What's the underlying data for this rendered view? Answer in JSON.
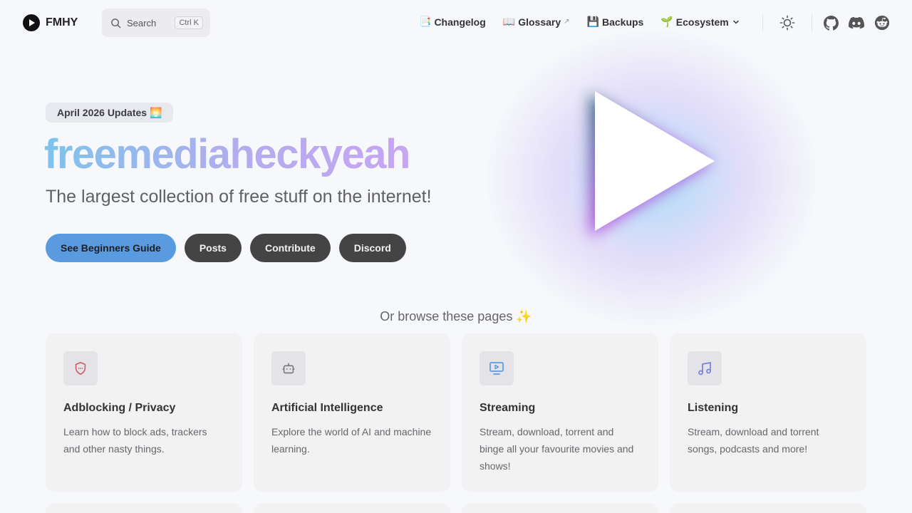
{
  "nav": {
    "logo_text": "FMHY",
    "search_label": "Search",
    "search_kbd_1": "Ctrl",
    "search_kbd_2": "K",
    "links": [
      {
        "emoji": "📑",
        "label": "Changelog"
      },
      {
        "emoji": "📖",
        "label": "Glossary",
        "external": "↗"
      },
      {
        "emoji": "💾",
        "label": "Backups"
      },
      {
        "emoji": "🌱",
        "label": "Ecosystem"
      }
    ]
  },
  "hero": {
    "badge": "April 2026 Updates 🌅",
    "title": "freemediaheckyeah",
    "tagline": "The largest collection of free stuff on the internet!",
    "actions": [
      "See Beginners Guide",
      "Posts",
      "Contribute",
      "Discord"
    ]
  },
  "browse": {
    "heading": "Or browse these pages ✨",
    "cards": [
      {
        "title": "Adblocking / Privacy",
        "desc": "Learn how to block ads, trackers and other nasty things.",
        "icon": "shield-icon"
      },
      {
        "title": "Artificial Intelligence",
        "desc": "Explore the world of AI and machine learning.",
        "icon": "robot-icon"
      },
      {
        "title": "Streaming",
        "desc": "Stream, download, torrent and binge all your favourite movies and shows!",
        "icon": "monitor-play-icon"
      },
      {
        "title": "Listening",
        "desc": "Stream, download and torrent songs, podcasts and more!",
        "icon": "music-note-icon"
      }
    ]
  },
  "colors": {
    "brand": "#5a9be0",
    "button_alt": "#444444",
    "title_gradient_start": "#7ec3eb",
    "title_gradient_end": "#c7a6f3"
  }
}
